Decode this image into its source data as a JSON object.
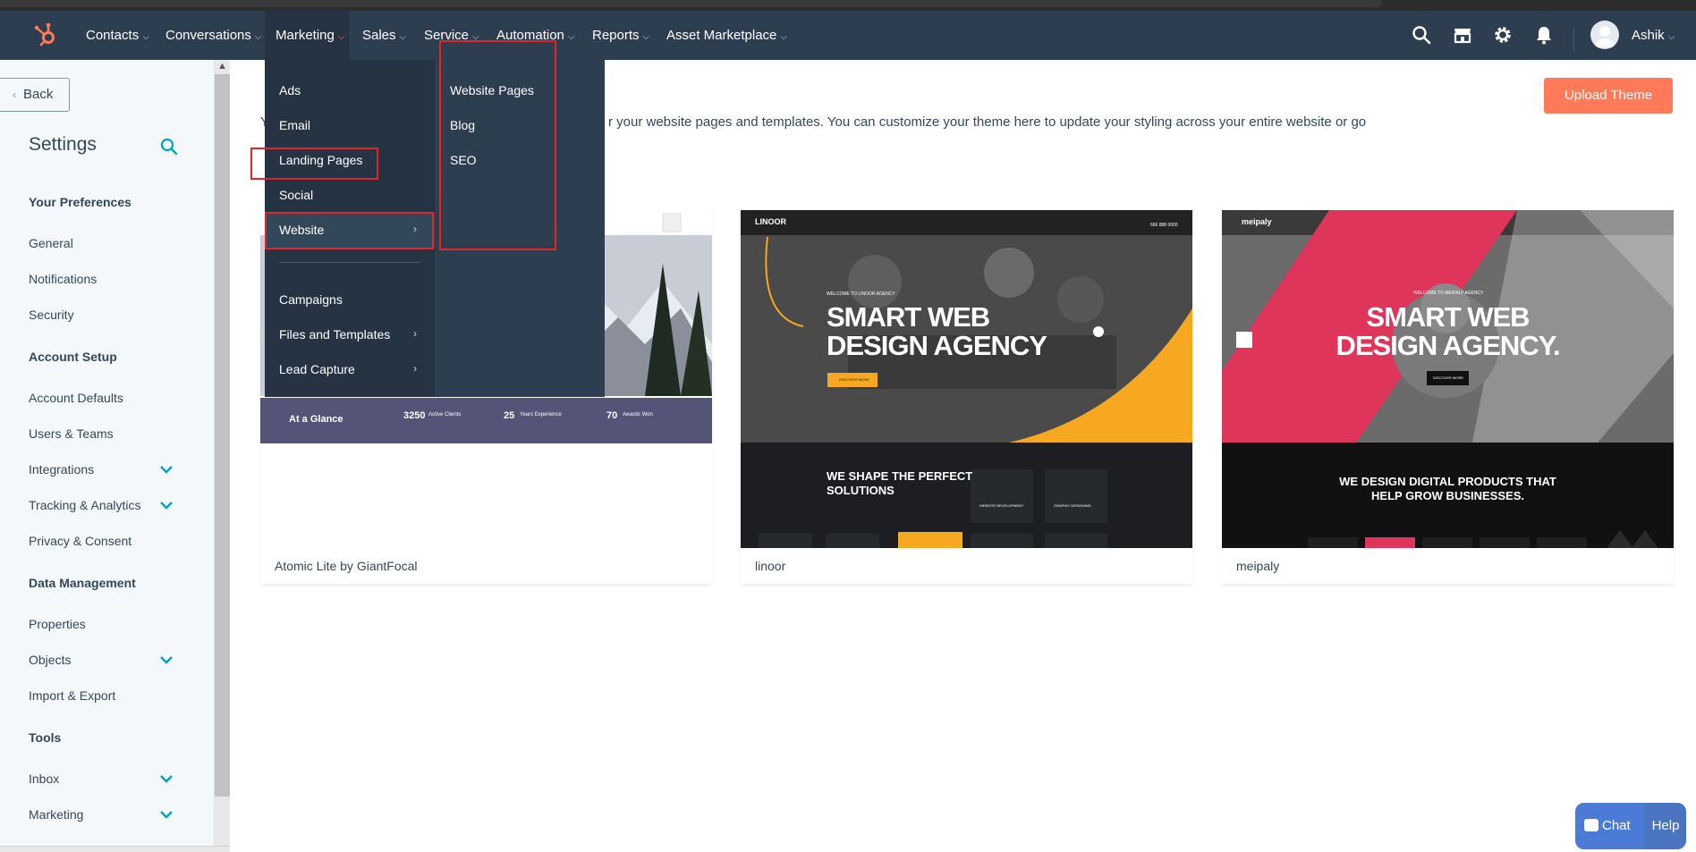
{
  "nav": {
    "items": [
      {
        "label": "Contacts"
      },
      {
        "label": "Conversations"
      },
      {
        "label": "Marketing"
      },
      {
        "label": "Sales"
      },
      {
        "label": "Service"
      },
      {
        "label": "Automation"
      },
      {
        "label": "Reports"
      },
      {
        "label": "Asset Marketplace"
      }
    ],
    "user_name": "Ashik"
  },
  "sidebar": {
    "back_label": "Back",
    "title": "Settings",
    "sections": [
      {
        "heading": "Your Preferences",
        "items": [
          "General",
          "Notifications",
          "Security"
        ]
      },
      {
        "heading": "Account Setup",
        "items": [
          "Account Defaults",
          "Users & Teams",
          "Integrations",
          "Tracking & Analytics",
          "Privacy & Consent"
        ]
      },
      {
        "heading": "Data Management",
        "items": [
          "Properties",
          "Objects",
          "Import & Export"
        ]
      },
      {
        "heading": "Tools",
        "items": [
          "Inbox",
          "Marketing"
        ]
      }
    ]
  },
  "dropdown": {
    "col1": [
      "Ads",
      "Email",
      "Landing Pages",
      "Social",
      "Website",
      "Campaigns",
      "Files and Templates",
      "Lead Capture"
    ],
    "col2": [
      "Website Pages",
      "Blog",
      "SEO"
    ]
  },
  "main": {
    "upload_label": "Upload Theme",
    "desc_prefix": "Y",
    "description": "r your website pages and templates. You can customize your theme here to update your styling across your entire website or go",
    "themes": [
      {
        "name": "Atomic Lite by GiantFocal",
        "preview": {
          "bar_title": "At a Glance",
          "stat1_num": "3250",
          "stat1_label": "Active Clients",
          "stat2_num": "25",
          "stat2_label": "Years Experience",
          "stat3_num": "70",
          "stat3_label": "Awards Won"
        }
      },
      {
        "name": "linoor",
        "preview": {
          "brand": "LINOOR",
          "welcome": "WELCOME TO LINOOR AGENCY",
          "headline1": "SMART WEB",
          "headline2": "DESIGN AGENCY",
          "cta": "DISCOVER MORE",
          "section1": "WE SHAPE THE PERFECT",
          "section2": "SOLUTIONS",
          "phone": "666 888 0000",
          "svc1": "WEBSITE DEVELOPMENT",
          "svc2": "GRAPHIC DESIGNING"
        }
      },
      {
        "name": "meipaly",
        "preview": {
          "brand": "meipaly",
          "welcome": "WELCOME TO MEIPALY AGENCY",
          "headline1": "SMART WEB",
          "headline2": "DESIGN AGENCY.",
          "cta": "DISCOVER MORE",
          "section1": "WE DESIGN DIGITAL PRODUCTS THAT",
          "section2": "HELP GROW BUSINESSES."
        }
      }
    ]
  },
  "chat": {
    "chat_label": "Chat",
    "help_label": "Help"
  },
  "colors": {
    "nav_bg": "#2d3e50",
    "accent": "#ff7a59",
    "annotation_red": "#e0262b",
    "chat_blue": "#4b7bd6"
  },
  "icons": [
    "hubspot-sprocket-icon",
    "search-icon",
    "marketplace-icon",
    "gear-icon",
    "bell-icon",
    "chevron-down-icon",
    "chat-bubble-icon"
  ]
}
